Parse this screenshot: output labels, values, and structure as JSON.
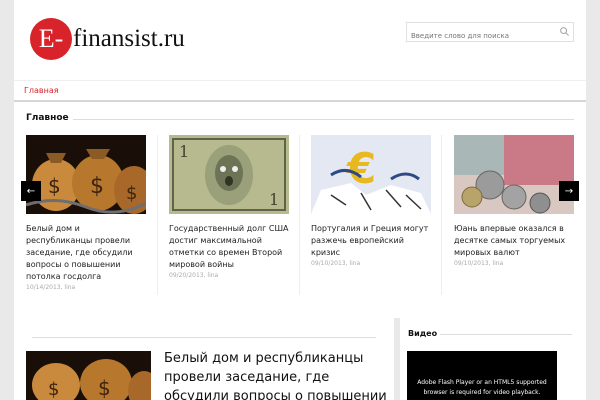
{
  "header": {
    "logo_letter": "E-",
    "logo_text": "finansist.ru",
    "search_placeholder": "Введите слово для поиска"
  },
  "nav": {
    "home": "Главная"
  },
  "featured": {
    "title": "Главное",
    "prev": "←",
    "next": "→",
    "items": [
      {
        "caption": "Белый дом и республиканцы провели заседание, где обсудили вопросы о повышении потолка госдолга",
        "meta": "10/14/2013, lina"
      },
      {
        "caption": "Государственный долг США достиг максимальной отметки со времен Второй мировой войны",
        "meta": "09/20/2013, lina"
      },
      {
        "caption": "Португалия и Греция могут разжечь европейский кризис",
        "meta": "09/10/2013, lina"
      },
      {
        "caption": "Юань впервые оказался в десятке самых торгуемых мировых валют",
        "meta": "09/10/2013, lina"
      }
    ]
  },
  "main": {
    "headline": "Белый дом и республиканцы провели заседание, где обсудили вопросы о повышении"
  },
  "sidebar": {
    "video_title": "Видео",
    "video_message": "Adobe Flash Player or an HTML5 supported browser is required for video playback."
  },
  "colors": {
    "accent": "#d8232a",
    "background": "#e9e9e9"
  }
}
